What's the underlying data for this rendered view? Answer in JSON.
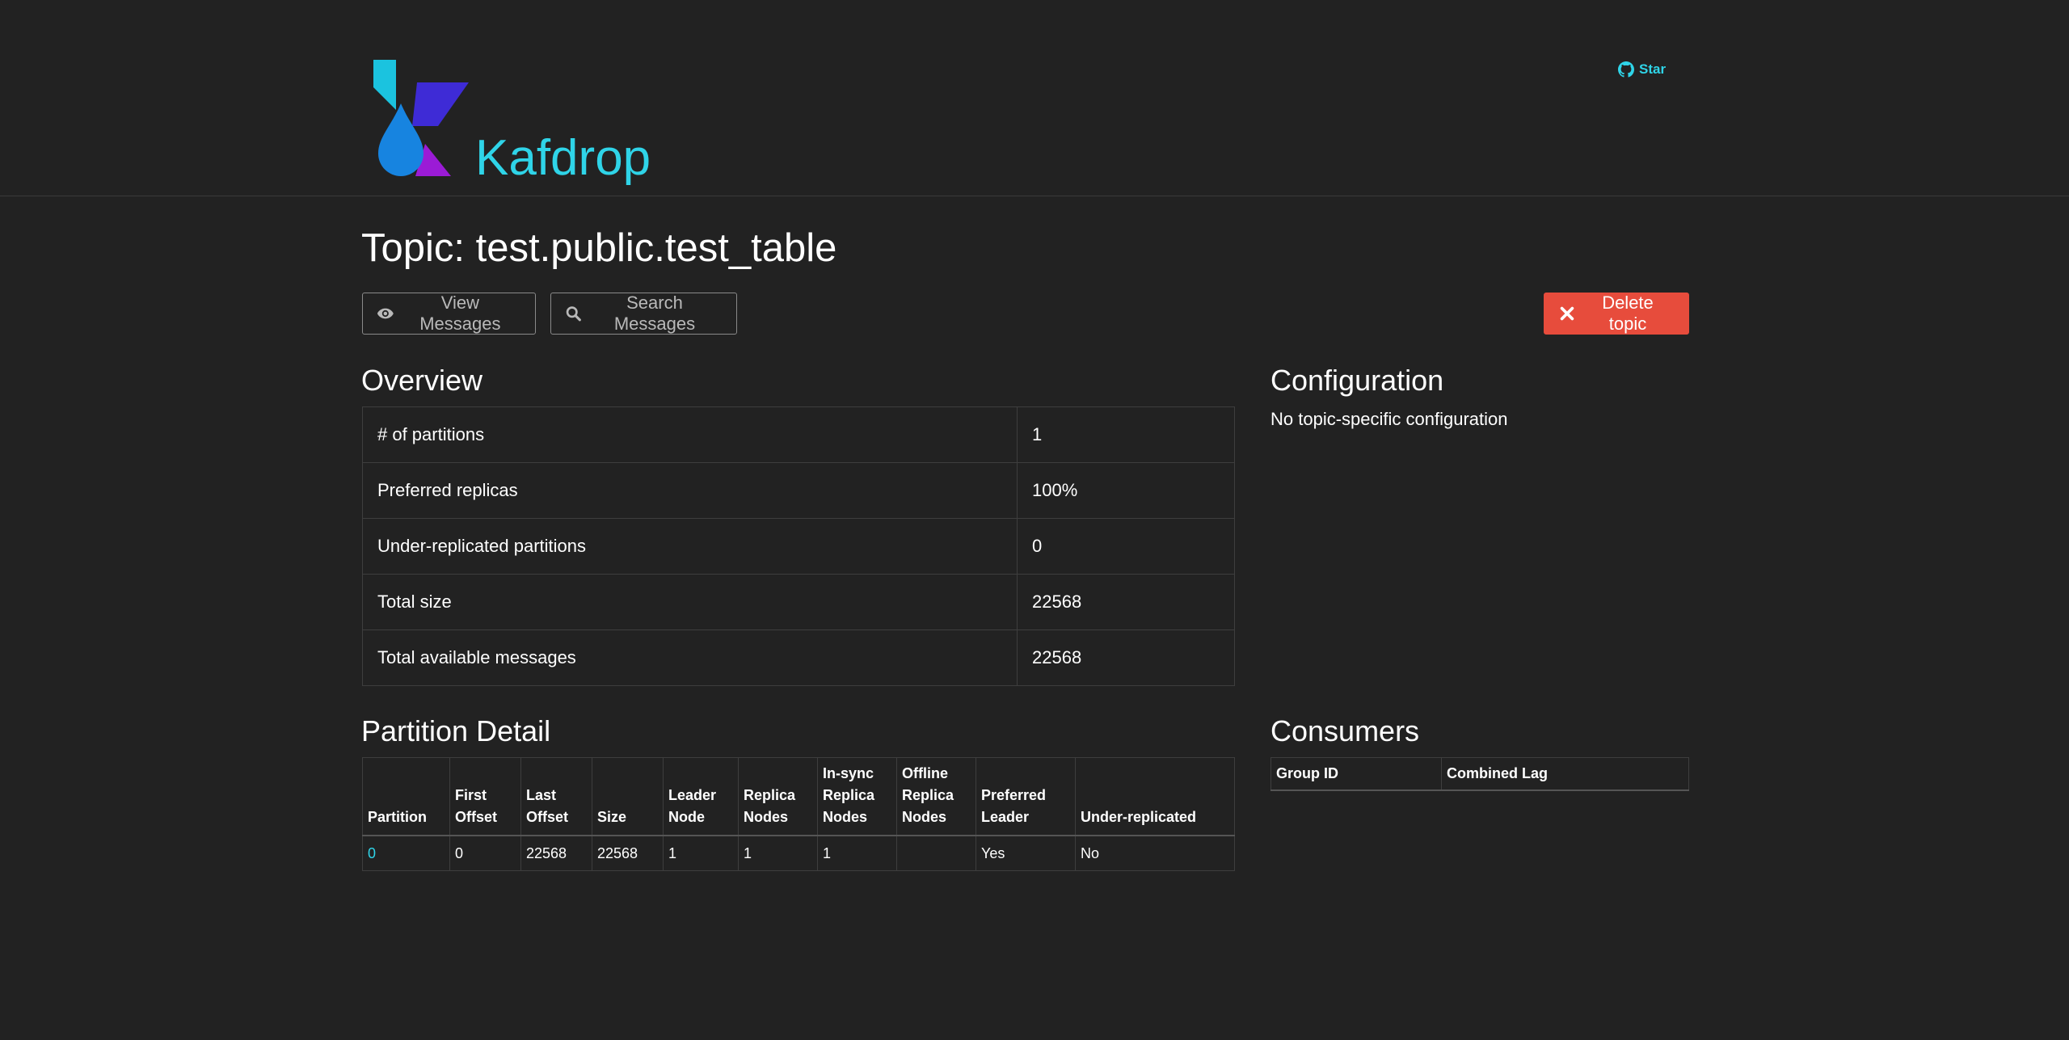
{
  "brand": {
    "name": "Kafdrop",
    "github_label": "Star"
  },
  "title": "Topic: test.public.test_table",
  "actions": {
    "view": "View Messages",
    "search": "Search Messages",
    "delete": "Delete topic"
  },
  "overview": {
    "heading": "Overview",
    "rows": [
      {
        "label": "# of partitions",
        "value": "1"
      },
      {
        "label": "Preferred replicas",
        "value": "100%"
      },
      {
        "label": "Under-replicated partitions",
        "value": "0"
      },
      {
        "label": "Total size",
        "value": "22568"
      },
      {
        "label": "Total available messages",
        "value": "22568"
      }
    ]
  },
  "configuration": {
    "heading": "Configuration",
    "text": "No topic-specific configuration"
  },
  "partition_detail": {
    "heading": "Partition Detail",
    "columns": [
      "Partition",
      "First Offset",
      "Last Offset",
      "Size",
      "Leader Node",
      "Replica Nodes",
      "In-sync Replica Nodes",
      "Offline Replica Nodes",
      "Preferred Leader",
      "Under-replicated"
    ],
    "rows": [
      [
        "0",
        "0",
        "22568",
        "22568",
        "1",
        "1",
        "1",
        "",
        "Yes",
        "No"
      ]
    ]
  },
  "consumers": {
    "heading": "Consumers",
    "columns": [
      "Group ID",
      "Combined Lag"
    ]
  },
  "colors": {
    "accent": "#2fd4e8",
    "danger": "#e74c3c",
    "background": "#222222"
  }
}
